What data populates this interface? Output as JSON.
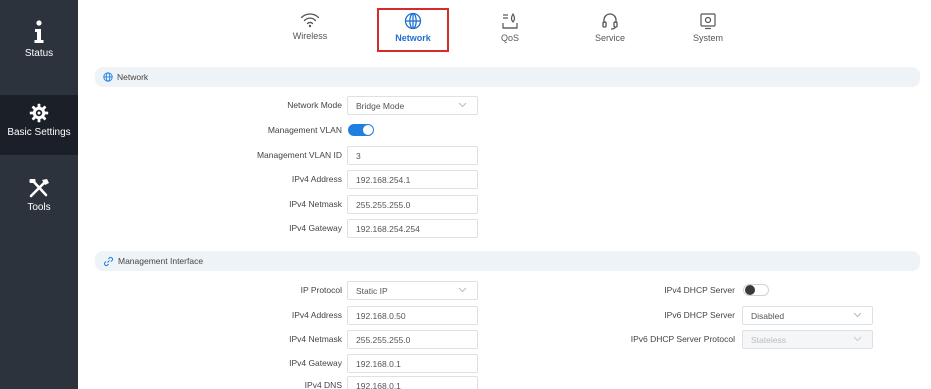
{
  "sidebar": {
    "items": [
      {
        "label": "Status",
        "icon": "info-icon"
      },
      {
        "label": "Basic Settings",
        "icon": "gear-icon"
      },
      {
        "label": "Tools",
        "icon": "tools-icon"
      }
    ]
  },
  "topnav": {
    "tabs": [
      {
        "label": "Wireless",
        "icon": "wifi-icon"
      },
      {
        "label": "Network",
        "icon": "globe-icon"
      },
      {
        "label": "QoS",
        "icon": "qos-icon"
      },
      {
        "label": "Service",
        "icon": "headset-icon"
      },
      {
        "label": "System",
        "icon": "system-icon"
      }
    ]
  },
  "network": {
    "title": "Network",
    "mode_label": "Network Mode",
    "mode_value": "Bridge Mode",
    "mgmt_vlan_label": "Management VLAN",
    "mgmt_vlan_on": true,
    "mgmt_vlan_id_label": "Management VLAN ID",
    "mgmt_vlan_id_value": "3",
    "ipv4_address_label": "IPv4 Address",
    "ipv4_address_value": "192.168.254.1",
    "ipv4_netmask_label": "IPv4 Netmask",
    "ipv4_netmask_value": "255.255.255.0",
    "ipv4_gateway_label": "IPv4 Gateway",
    "ipv4_gateway_value": "192.168.254.254"
  },
  "mgmt_interface": {
    "title": "Management Interface",
    "ip_protocol_label": "IP Protocol",
    "ip_protocol_value": "Static IP",
    "ipv4_address_label": "IPv4 Address",
    "ipv4_address_value": "192.168.0.50",
    "ipv4_netmask_label": "IPv4 Netmask",
    "ipv4_netmask_value": "255.255.255.0",
    "ipv4_gateway_label": "IPv4 Gateway",
    "ipv4_gateway_value": "192.168.0.1",
    "ipv4_dns_label": "IPv4 DNS",
    "ipv4_dns_value": "192.168.0.1",
    "ipv4_dhcp_server_label": "IPv4 DHCP Server",
    "ipv4_dhcp_server_on": false,
    "ipv6_dhcp_server_label": "IPv6 DHCP Server",
    "ipv6_dhcp_server_value": "Disabled",
    "ipv6_dhcp_protocol_label": "IPv6 DHCP Server Protocol",
    "ipv6_dhcp_protocol_value": "Stateless"
  },
  "colors": {
    "sidebar_bg": "#2c333d",
    "sidebar_active_bg": "#1b2028",
    "accent": "#1f7fe0",
    "active_tab_border": "#d42b2b"
  }
}
